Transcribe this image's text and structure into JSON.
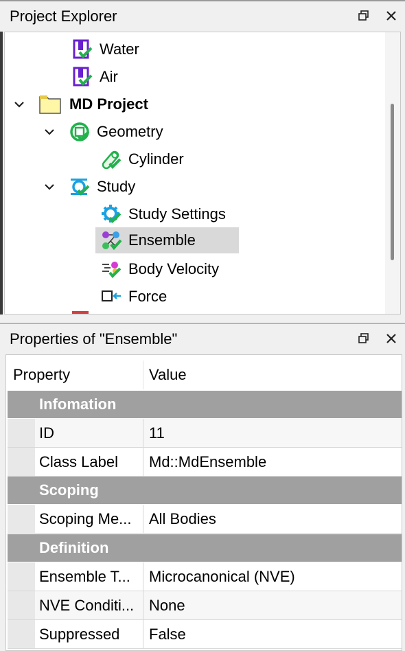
{
  "explorer": {
    "title": "Project Explorer",
    "items": [
      {
        "label": "Water",
        "icon": "material-icon"
      },
      {
        "label": "Air",
        "icon": "material-icon"
      },
      {
        "label": "MD Project",
        "icon": "folder-icon",
        "expanded": true,
        "bold": true
      },
      {
        "label": "Geometry",
        "icon": "geometry-icon",
        "expanded": true
      },
      {
        "label": "Cylinder",
        "icon": "cylinder-icon"
      },
      {
        "label": "Study",
        "icon": "study-icon",
        "expanded": true
      },
      {
        "label": "Study Settings",
        "icon": "study-settings-icon"
      },
      {
        "label": "Ensemble",
        "icon": "ensemble-icon",
        "selected": true
      },
      {
        "label": "Body Velocity",
        "icon": "body-velocity-icon"
      },
      {
        "label": "Force",
        "icon": "force-icon"
      }
    ]
  },
  "properties": {
    "title": "Properties of \"Ensemble\"",
    "columns": {
      "property": "Property",
      "value": "Value"
    },
    "groups": [
      {
        "name": "Infomation",
        "rows": [
          {
            "property": "ID",
            "value": "11"
          },
          {
            "property": "Class Label",
            "value": "Md::MdEnsemble"
          }
        ]
      },
      {
        "name": "Scoping",
        "rows": [
          {
            "property": "Scoping Me...",
            "value": "All Bodies"
          }
        ]
      },
      {
        "name": "Definition",
        "rows": [
          {
            "property": "Ensemble T...",
            "value": "Microcanonical (NVE)"
          },
          {
            "property": "NVE Conditi...",
            "value": "None"
          },
          {
            "property": "Suppressed",
            "value": "False"
          }
        ]
      }
    ]
  },
  "colors": {
    "accent_green": "#22b14c",
    "material_purple": "#6a1fd0",
    "study_blue": "#1ba1e2",
    "group_header": "#a0a0a0",
    "selection": "#d9d9d9"
  }
}
